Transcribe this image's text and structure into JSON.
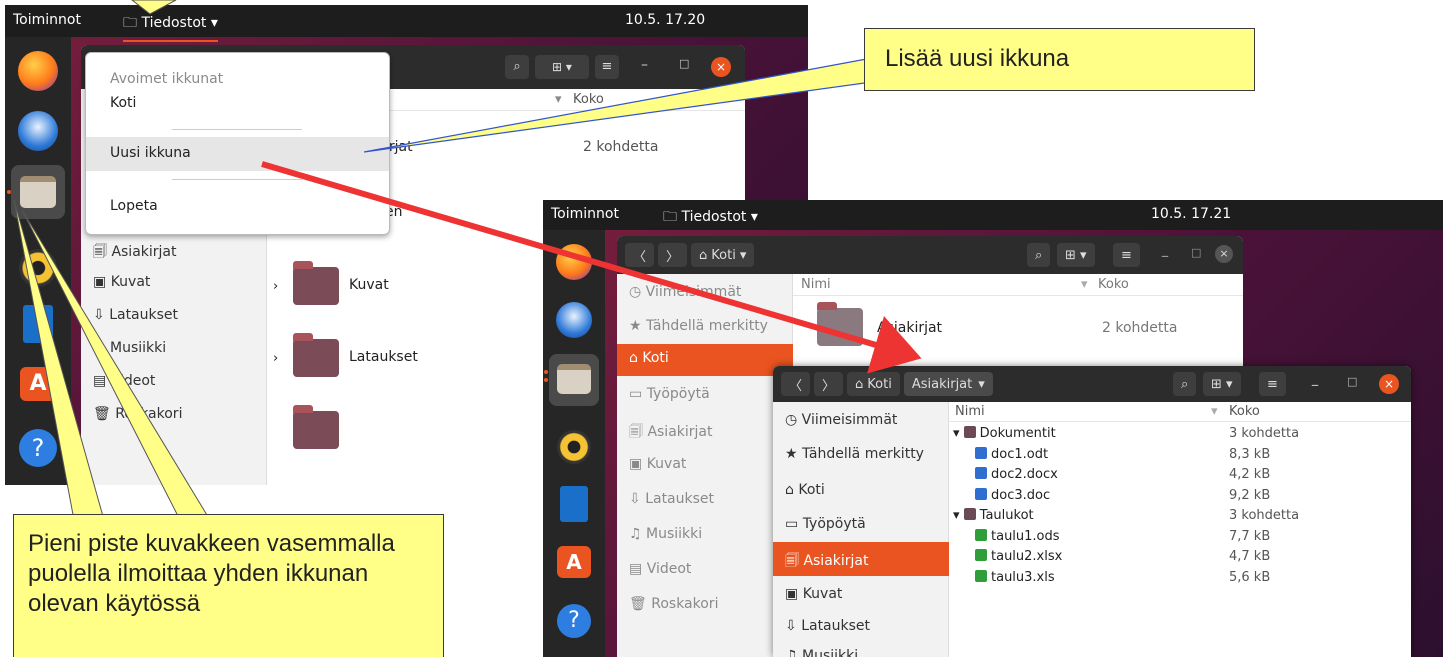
{
  "topbar1": {
    "activities": "Toiminnot",
    "app": "Tiedostot",
    "clock": "10.5.  17.20"
  },
  "topbar2": {
    "activities": "Toiminnot",
    "app": "Tiedostot",
    "clock": "10.5.  17.21"
  },
  "menu": {
    "open_windows": "Avoimet ikkunat",
    "home": "Koti",
    "new_window": "Uusi ikkuna",
    "quit": "Lopeta"
  },
  "win1": {
    "col_size": "Koko",
    "row_docs_fragment": "irjat",
    "row_docs_size": "2 kohdetta",
    "row_desk_fragment": "en",
    "side": [
      "Asiakirjat",
      "Kuvat",
      "Lataukset",
      "Musiikki",
      "Videot",
      "Roskakori"
    ],
    "folders": [
      "Kuvat",
      "Lataukset"
    ]
  },
  "win2": {
    "crumb": "Koti",
    "col_name": "Nimi",
    "col_size": "Koko",
    "row_name": "Asiakirjat",
    "row_size": "2 kohdetta",
    "side": [
      "Viimeisimmät",
      "Tähdellä merkitty",
      "Koti",
      "Työpöytä",
      "Asiakirjat",
      "Kuvat",
      "Lataukset",
      "Musiikki",
      "Videot",
      "Roskakori"
    ]
  },
  "win3": {
    "crumb_home": "Koti",
    "crumb_docs": "Asiakirjat",
    "col_name": "Nimi",
    "col_size": "Koko",
    "side": [
      "Viimeisimmät",
      "Tähdellä merkitty",
      "Koti",
      "Työpöytä",
      "Asiakirjat",
      "Kuvat",
      "Lataukset",
      "Musiikki"
    ],
    "files": [
      {
        "name": "Dokumentit",
        "size": "3 kohdetta",
        "kind": "folder"
      },
      {
        "name": "doc1.odt",
        "size": "8,3 kB",
        "kind": "odt"
      },
      {
        "name": "doc2.docx",
        "size": "4,2 kB",
        "kind": "doc"
      },
      {
        "name": "doc3.doc",
        "size": "9,2 kB",
        "kind": "doc"
      },
      {
        "name": "Taulukot",
        "size": "3 kohdetta",
        "kind": "folder"
      },
      {
        "name": "taulu1.ods",
        "size": "7,7 kB",
        "kind": "ods"
      },
      {
        "name": "taulu2.xlsx",
        "size": "4,7 kB",
        "kind": "xls"
      },
      {
        "name": "taulu3.xls",
        "size": "5,6 kB",
        "kind": "xls"
      }
    ]
  },
  "callouts": {
    "new_window": "Lisää uusi ikkuna",
    "dot_info": "Pieni piste kuvakkeen vasemmalla puolella ilmoittaa yhden ikkunan olevan käytössä"
  },
  "colors": {
    "accent": "#e95420",
    "callout_bg": "#ffff88",
    "arrow": "#ee3333"
  }
}
